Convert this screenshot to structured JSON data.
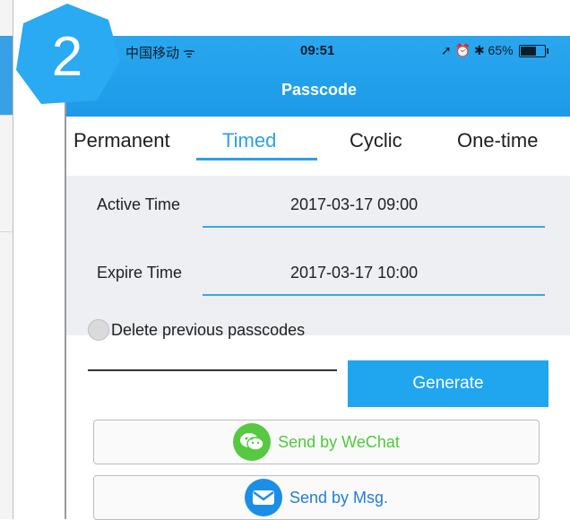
{
  "step_badge": {
    "number": "2",
    "color": "#29aaf2"
  },
  "status_bar": {
    "carrier": "中国移动 ᯤ",
    "time": "09:51",
    "right": "➚ ⏰ ✱ 65%"
  },
  "header": {
    "title": "Passcode"
  },
  "tabs": [
    {
      "label": "Permanent"
    },
    {
      "label": "Timed"
    },
    {
      "label": "Cyclic"
    },
    {
      "label": "One-time"
    }
  ],
  "active_tab": "Timed",
  "form": {
    "active_time_label": "Active Time",
    "active_time_value": "2017-03-17 09:00",
    "expire_time_label": "Expire Time",
    "expire_time_value": "2017-03-17 10:00"
  },
  "delete_option": {
    "label": "Delete previous passcodes",
    "checked": false
  },
  "generate_button": {
    "label": "Generate"
  },
  "send_wechat": {
    "label": "Send by WeChat",
    "icon": "wechat-icon"
  },
  "send_msg": {
    "label": "Send by Msg.",
    "icon": "envelope-icon"
  },
  "colors": {
    "accent": "#1fa6ef",
    "wechat": "#55c93f",
    "msg": "#1b8fe6"
  }
}
